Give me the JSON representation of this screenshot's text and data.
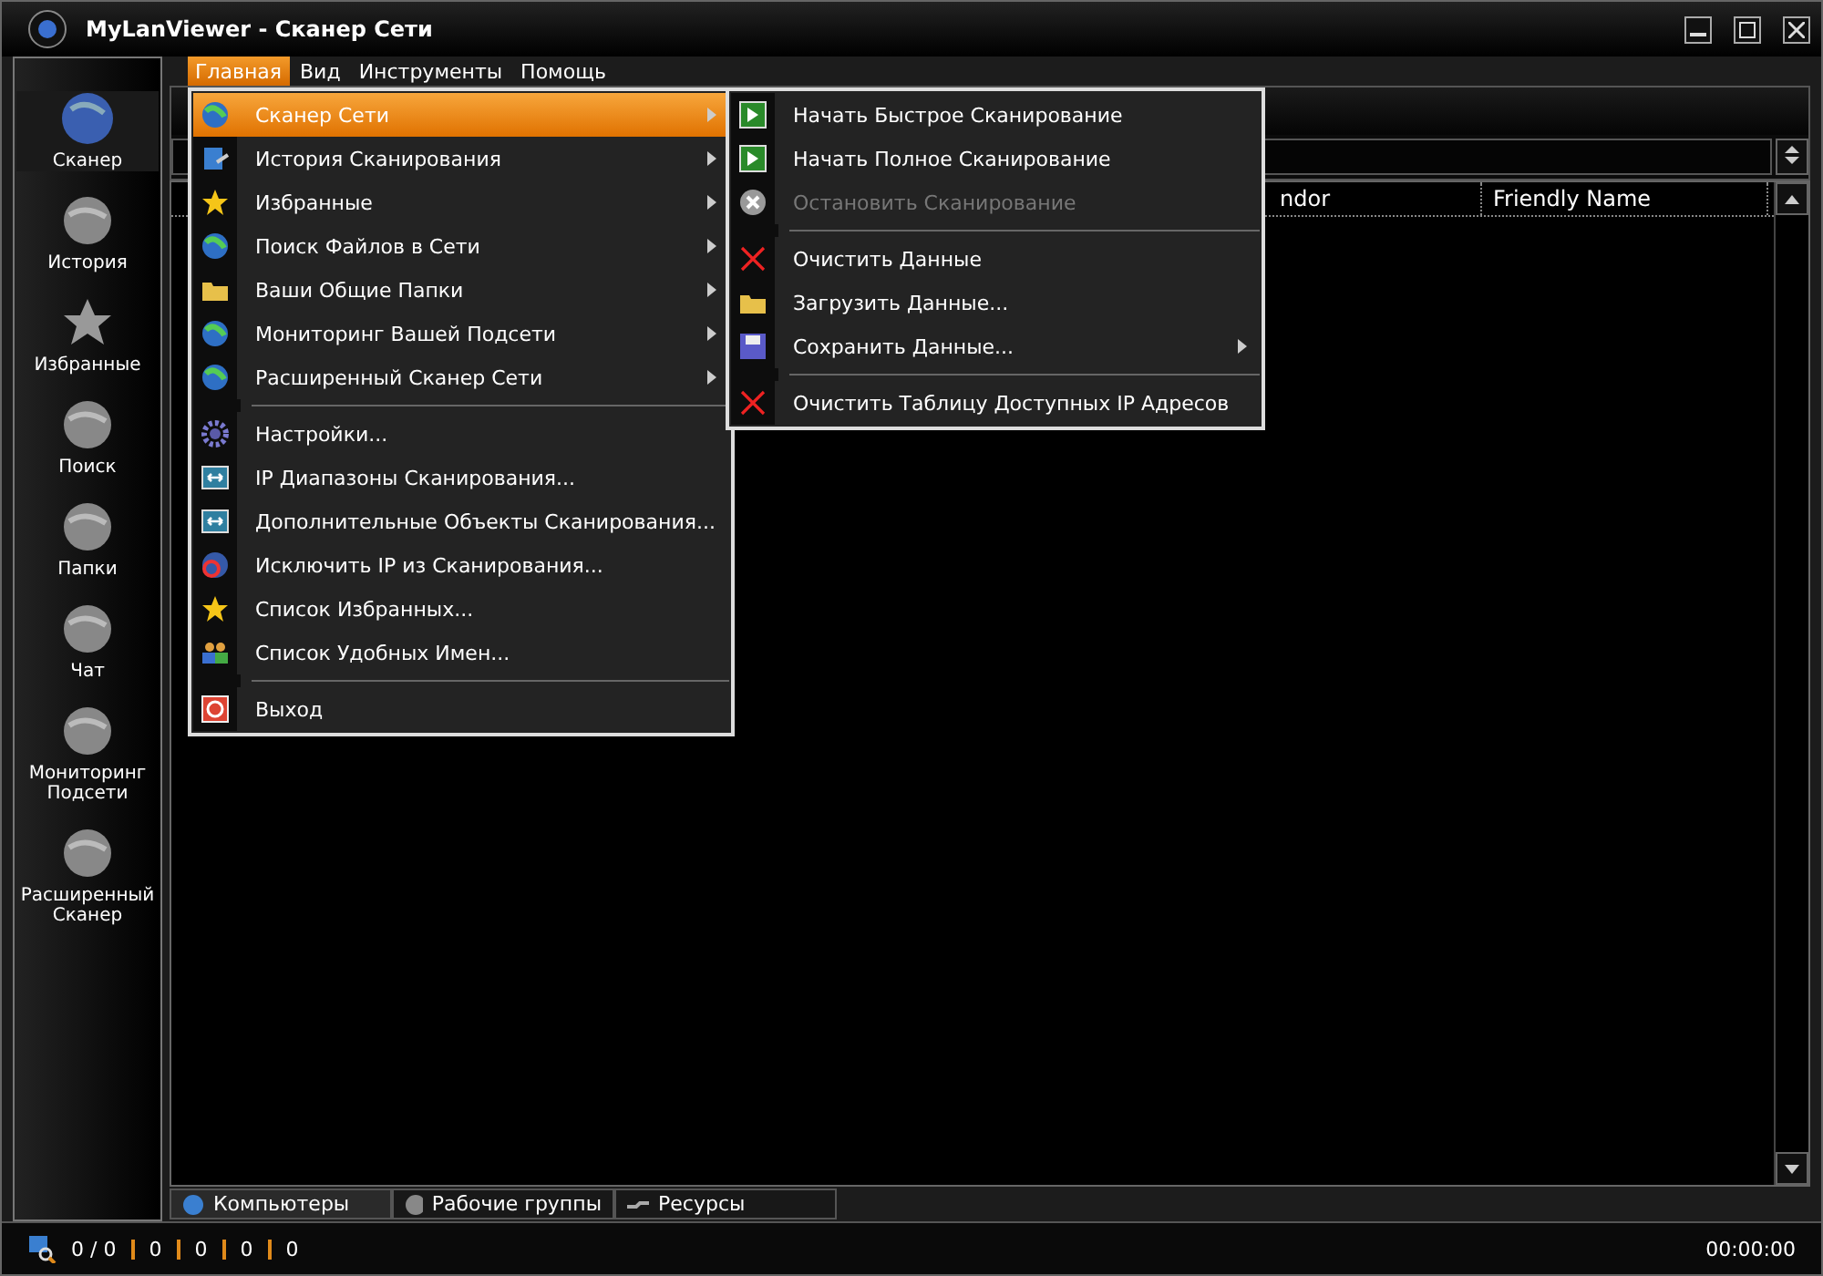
{
  "window": {
    "title": "MyLanViewer - Сканер Сети"
  },
  "menu_bar": [
    {
      "label": "Главная",
      "selected": true
    },
    {
      "label": "Вид",
      "selected": false
    },
    {
      "label": "Инструменты",
      "selected": false
    },
    {
      "label": "Помощь",
      "selected": false
    }
  ],
  "sidebar": [
    {
      "label": "Сканер",
      "selected": true
    },
    {
      "label": "История",
      "selected": false
    },
    {
      "label": "Избранные",
      "selected": false
    },
    {
      "label": "Поиск",
      "selected": false
    },
    {
      "label": "Папки",
      "selected": false
    },
    {
      "label": "Чат",
      "selected": false
    },
    {
      "label": "Мониторинг Подсети",
      "selected": false
    },
    {
      "label": "Расширенный Сканер",
      "selected": false
    }
  ],
  "table": {
    "columns": [
      "ndor",
      "Friendly Name"
    ]
  },
  "main_menu": [
    {
      "kind": "item",
      "label": "Сканер Сети",
      "selected": true,
      "has_submenu": true
    },
    {
      "kind": "item",
      "label": "История Сканирования",
      "selected": false,
      "has_submenu": true
    },
    {
      "kind": "item",
      "label": "Избранные",
      "selected": false,
      "has_submenu": true
    },
    {
      "kind": "item",
      "label": "Поиск Файлов в Сети",
      "selected": false,
      "has_submenu": true
    },
    {
      "kind": "item",
      "label": "Ваши Общие Папки",
      "selected": false,
      "has_submenu": true
    },
    {
      "kind": "item",
      "label": "Мониторинг Вашей Подсети",
      "selected": false,
      "has_submenu": true
    },
    {
      "kind": "item",
      "label": "Расширенный Сканер Сети",
      "selected": false,
      "has_submenu": true
    },
    {
      "kind": "separator"
    },
    {
      "kind": "item",
      "label": "Настройки...",
      "selected": false,
      "has_submenu": false
    },
    {
      "kind": "item",
      "label": "IP Диапазоны Сканирования...",
      "selected": false,
      "has_submenu": false
    },
    {
      "kind": "item",
      "label": "Дополнительные Объекты Сканирования...",
      "selected": false,
      "has_submenu": false
    },
    {
      "kind": "item",
      "label": "Исключить IP из Сканирования...",
      "selected": false,
      "has_submenu": false
    },
    {
      "kind": "item",
      "label": "Список Избранных...",
      "selected": false,
      "has_submenu": false
    },
    {
      "kind": "item",
      "label": "Список Удобных Имен...",
      "selected": false,
      "has_submenu": false
    },
    {
      "kind": "separator"
    },
    {
      "kind": "item",
      "label": "Выход",
      "selected": false,
      "has_submenu": false
    }
  ],
  "submenu": [
    {
      "kind": "item",
      "label": "Начать Быстрое Сканирование",
      "disabled": false,
      "has_submenu": false
    },
    {
      "kind": "item",
      "label": "Начать Полное Сканирование",
      "disabled": false,
      "has_submenu": false
    },
    {
      "kind": "item",
      "label": "Остановить Сканирование",
      "disabled": true,
      "has_submenu": false
    },
    {
      "kind": "separator"
    },
    {
      "kind": "item",
      "label": "Очистить Данные",
      "disabled": false,
      "has_submenu": false
    },
    {
      "kind": "item",
      "label": "Загрузить Данные...",
      "disabled": false,
      "has_submenu": false
    },
    {
      "kind": "item",
      "label": "Сохранить Данные...",
      "disabled": false,
      "has_submenu": true
    },
    {
      "kind": "separator"
    },
    {
      "kind": "item",
      "label": "Очистить Таблицу Доступных IP Адресов",
      "disabled": false,
      "has_submenu": false
    }
  ],
  "bottom_tabs": [
    {
      "label": "Компьютеры",
      "selected": true
    },
    {
      "label": "Рабочие группы",
      "selected": false
    },
    {
      "label": "Ресурсы",
      "selected": false
    }
  ],
  "status_bar": {
    "counts": [
      "0 / 0",
      "0",
      "0",
      "0",
      "0"
    ],
    "time": "00:00:00"
  }
}
